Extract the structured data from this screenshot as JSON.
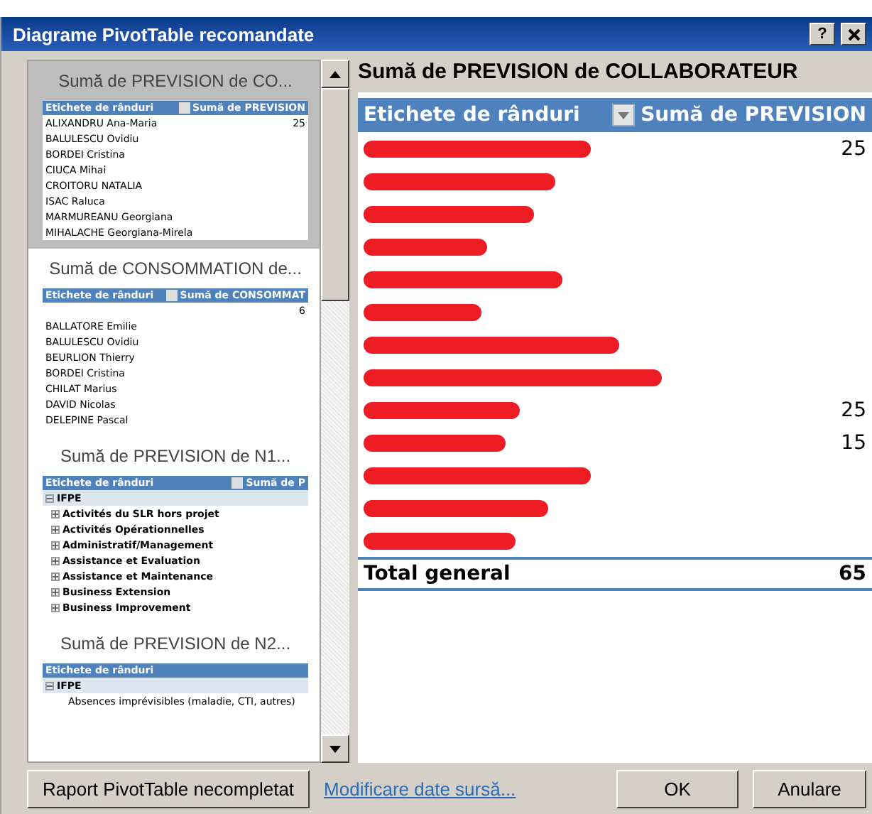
{
  "window": {
    "title": "Diagrame PivotTable recomandate",
    "help": "?"
  },
  "previews": [
    {
      "title": "Sumă de PREVISION de CO...",
      "selected": true,
      "columns": [
        "Etichete de rânduri",
        "Sumă de PREVISION"
      ],
      "rows": [
        {
          "kind": "item",
          "label": "ALIXANDRU Ana-Maria",
          "value": "25"
        },
        {
          "kind": "item",
          "label": "BALULESCU Ovidiu"
        },
        {
          "kind": "item",
          "label": "BORDEI Cristina"
        },
        {
          "kind": "item",
          "label": "CIUCA Mihai"
        },
        {
          "kind": "item",
          "label": "CROITORU NATALIA"
        },
        {
          "kind": "item",
          "label": "ISAC Raluca"
        },
        {
          "kind": "item",
          "label": "MARMUREANU Georgiana"
        },
        {
          "kind": "item",
          "label": "MIHALACHE Georgiana-Mirela"
        }
      ]
    },
    {
      "title": "Sumă de CONSOMMATION de...",
      "selected": false,
      "columns": [
        "Etichete de rânduri",
        "Sumă de CONSOMMAT"
      ],
      "rows": [
        {
          "kind": "item",
          "label": "",
          "value": "6"
        },
        {
          "kind": "item",
          "label": "BALLATORE Emilie"
        },
        {
          "kind": "item",
          "label": "BALULESCU Ovidiu"
        },
        {
          "kind": "item",
          "label": "BEURLION Thierry"
        },
        {
          "kind": "item",
          "label": "BORDEI Cristina"
        },
        {
          "kind": "item",
          "label": "CHILAT Marius"
        },
        {
          "kind": "item",
          "label": "DAVID Nicolas"
        },
        {
          "kind": "item",
          "label": "DELEPINE Pascal"
        }
      ]
    },
    {
      "title": "Sumă de PREVISION de N1...",
      "selected": false,
      "columns": [
        "Etichete de rânduri",
        "Sumă de P"
      ],
      "rows": [
        {
          "kind": "group",
          "label": "IFPE",
          "expanded": true
        },
        {
          "kind": "child",
          "label": "Activités du SLR hors projet",
          "expanded": false
        },
        {
          "kind": "child",
          "label": "Activités Opérationnelles",
          "expanded": false
        },
        {
          "kind": "child",
          "label": "Administratif/Management",
          "expanded": false
        },
        {
          "kind": "child",
          "label": "Assistance et Evaluation",
          "expanded": false
        },
        {
          "kind": "child",
          "label": "Assistance et Maintenance",
          "expanded": false
        },
        {
          "kind": "child",
          "label": "Business Extension",
          "expanded": false
        },
        {
          "kind": "child",
          "label": "Business Improvement",
          "expanded": false
        }
      ]
    },
    {
      "title": "Sumă de PREVISION de N2...",
      "selected": false,
      "columns": [
        "Etichete de rânduri"
      ],
      "rows": [
        {
          "kind": "group",
          "label": "IFPE",
          "expanded": true
        },
        {
          "kind": "detail",
          "label": "Absences imprévisibles (maladie, CTI, autres)"
        }
      ]
    }
  ],
  "chart_preview": {
    "title": "Sumă de PREVISION de COLLABORATEUR",
    "columns": [
      "Etichete de rânduri",
      "Sumă de PREVISION"
    ],
    "rows": [
      {
        "redacted": true,
        "value": "25"
      },
      {
        "redacted": true
      },
      {
        "redacted": true
      },
      {
        "redacted": true
      },
      {
        "redacted": true
      },
      {
        "redacted": true
      },
      {
        "redacted": true
      },
      {
        "redacted": true
      },
      {
        "redacted": true,
        "value": "25"
      },
      {
        "redacted": true,
        "value": "15"
      },
      {
        "redacted": true
      },
      {
        "redacted": true
      },
      {
        "redacted": true
      }
    ],
    "total": {
      "label": "Total general",
      "value": "65"
    }
  },
  "buttons": {
    "blank_report": "Raport PivotTable necompletat",
    "change_source": "Modificare date sursă...",
    "ok": "OK",
    "cancel": "Anulare"
  }
}
